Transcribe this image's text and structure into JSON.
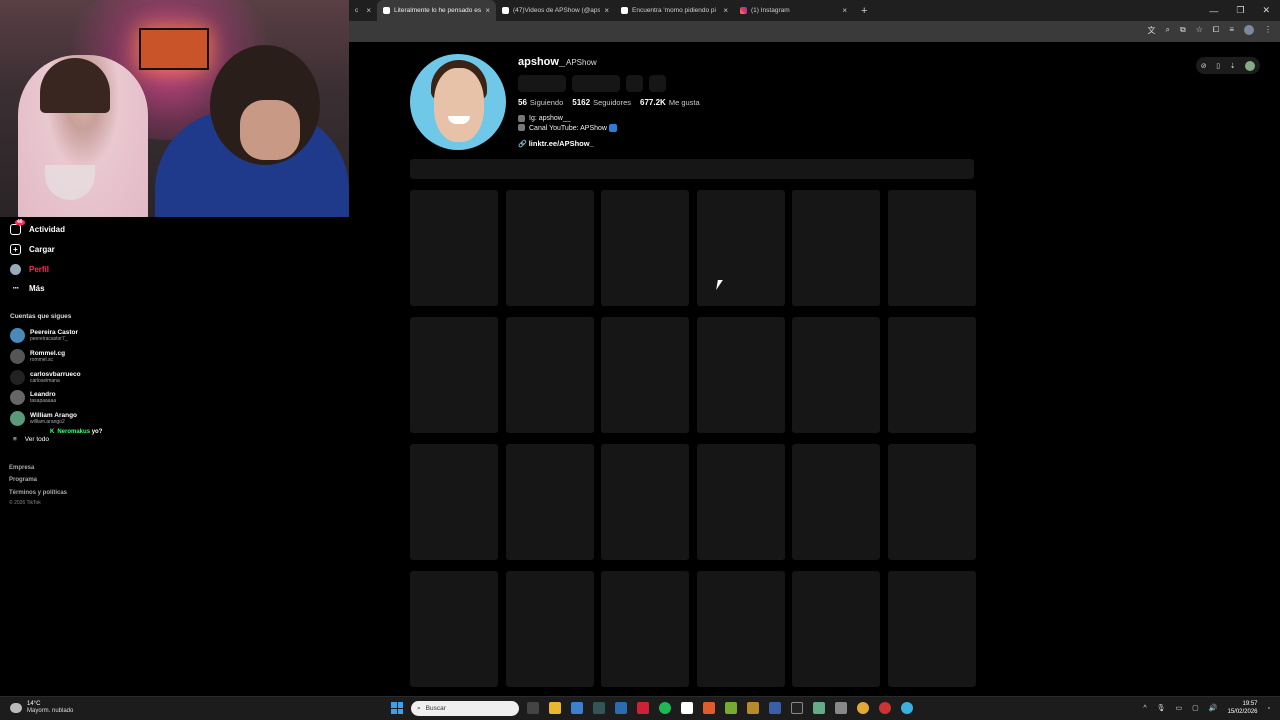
{
  "browser": {
    "tabs": [
      {
        "label": "c",
        "favicon": "tiktok-icon",
        "active": false
      },
      {
        "label": "Literalmente lo he pensado est",
        "favicon": "tiktok-icon",
        "active": true
      },
      {
        "label": "(47)Videos de APShow (@apsh",
        "favicon": "tiktok-icon",
        "active": false
      },
      {
        "label": "Encuentra 'momo pidiendo pi",
        "favicon": "tiktok-icon",
        "active": false
      },
      {
        "label": "(1) Instagram",
        "favicon": "instagram-icon",
        "active": false
      }
    ],
    "new_tab": "+",
    "close_glyph": "×",
    "window_controls": [
      "—",
      "❐",
      "✕"
    ]
  },
  "profile": {
    "username": "apshow_",
    "nickname": "APShow",
    "stats": {
      "following_count": "56",
      "following_label": "Siguiendo",
      "followers_count": "5162",
      "followers_label": "Seguidores",
      "likes_count": "677.2K",
      "likes_label": "Me gusta"
    },
    "bio_lines": [
      "Ig: apshow__",
      "Canal YouTube: APShow"
    ],
    "link": "linktr.ee/APShow_",
    "grid_placeholders": 24
  },
  "sidebar": {
    "nav": [
      {
        "label": "Actividad",
        "icon": "activity-icon",
        "badge": "46",
        "active": false
      },
      {
        "label": "Cargar",
        "icon": "upload-icon",
        "active": false
      },
      {
        "label": "Perfil",
        "icon": "profile-icon",
        "active": true
      },
      {
        "label": "Más",
        "icon": "more-icon",
        "active": false
      }
    ],
    "following_title": "Cuentas que sigues",
    "accounts": [
      {
        "name": "Peereira Castor",
        "handle": "peereiracastor7_"
      },
      {
        "name": "Rommel.cg",
        "handle": "rommel.sc"
      },
      {
        "name": "carlosvbarrueco",
        "handle": "carloselmana"
      },
      {
        "name": "Leandro",
        "handle": "tasapaaaaa"
      },
      {
        "name": "William Arango",
        "handle": "william.arango2"
      }
    ],
    "see_all": "Ver todo",
    "chat": {
      "kick_badge": "K",
      "user": "Neromakus",
      "message": "yo?"
    },
    "footer_links": [
      "Empresa",
      "Programa",
      "Términos y políticas"
    ],
    "copyright": "© 2026 TikTok"
  },
  "taskbar": {
    "temperature": "14°C",
    "weather": "Mayorm. nublado",
    "search_placeholder": "Buscar",
    "time": "19:57",
    "date": "15/02/2026"
  },
  "colors": {
    "accent": "#fe2c55",
    "background": "#000000",
    "placeholder": "#161616",
    "kick_green": "#3cff7a"
  }
}
